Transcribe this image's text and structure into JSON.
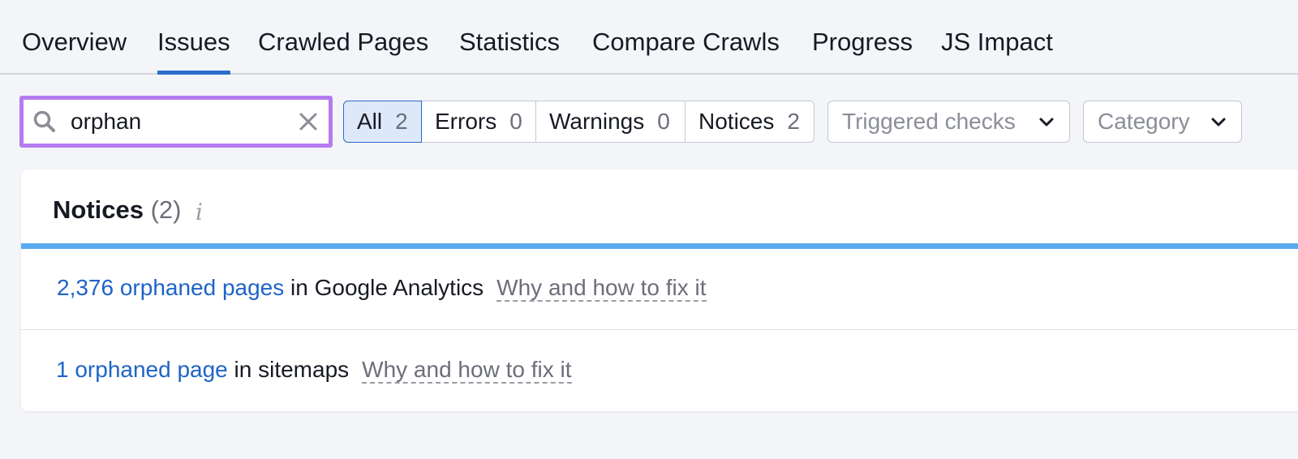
{
  "tabs": [
    {
      "label": "Overview"
    },
    {
      "label": "Issues",
      "active": true
    },
    {
      "label": "Crawled Pages"
    },
    {
      "label": "Statistics"
    },
    {
      "label": "Compare Crawls"
    },
    {
      "label": "Progress"
    },
    {
      "label": "JS Impact"
    }
  ],
  "search": {
    "value": "orphan",
    "placeholder": ""
  },
  "filters": [
    {
      "label": "All",
      "count": "2",
      "active": true
    },
    {
      "label": "Errors",
      "count": "0"
    },
    {
      "label": "Warnings",
      "count": "0"
    },
    {
      "label": "Notices",
      "count": "2"
    }
  ],
  "dropdowns": {
    "triggered": "Triggered checks",
    "category": "Category"
  },
  "card": {
    "title": "Notices",
    "count": "(2)",
    "info_icon": "i",
    "issues": [
      {
        "link": "2,376 orphaned pages",
        "text": " in Google Analytics",
        "fix": "Why and how to fix it"
      },
      {
        "link": "1 orphaned page",
        "text": " in sitemaps",
        "fix": "Why and how to fix it"
      }
    ]
  },
  "colors": {
    "accent": "#2c6ecb",
    "search_highlight": "#b57bf0",
    "notice_bar": "#5aaaf0",
    "link": "#1e64c8"
  },
  "icons": {
    "search": "search-icon",
    "clear": "close-icon",
    "dropdown": "chevron-down-icon",
    "info": "info-icon"
  }
}
